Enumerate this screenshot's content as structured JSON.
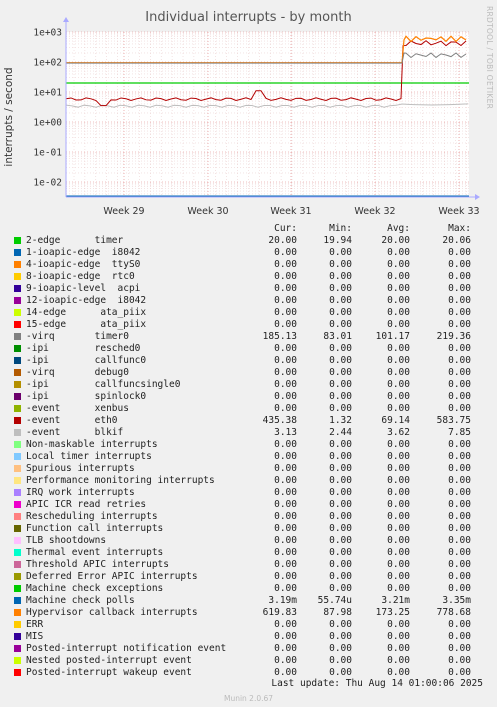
{
  "chart_data": {
    "type": "line",
    "title": "Individual interrupts - by month",
    "ylabel": "interrupts / second",
    "yscale": "log",
    "ylim": [
      0.003,
      1000
    ],
    "y_ticks": [
      "1e-02",
      "1e-01",
      "1e+00",
      "1e+01",
      "1e+02",
      "1e+03"
    ],
    "x_ticks": [
      "Week 29",
      "Week 30",
      "Week 31",
      "Week 32",
      "Week 33"
    ],
    "grid": true,
    "series": [
      {
        "name": "2-edge      timer",
        "values": [
          20.0,
          20.0,
          20.0,
          20.0,
          20.0,
          20.0
        ]
      },
      {
        "name": "-virq       timer0",
        "values": [
          100,
          100,
          100,
          100,
          100,
          110,
          219,
          160,
          185
        ]
      },
      {
        "name": "-event      eth0",
        "values": [
          6,
          5.5,
          6,
          5.8,
          6,
          6.2,
          400,
          435
        ]
      },
      {
        "name": "-event      blkif",
        "values": [
          3.6,
          3.5,
          3.6,
          3.5,
          3.4,
          3.6,
          3.7,
          3.13
        ]
      },
      {
        "name": "Machine check polls",
        "values": [
          0.0035,
          0.0035,
          0.0035,
          0.0035,
          0.0035
        ]
      },
      {
        "name": "Hypervisor callback interrupts",
        "values": [
          95,
          95,
          95,
          95,
          95,
          600,
          778,
          620
        ]
      }
    ]
  },
  "legend_header": {
    "cur": "Cur:",
    "min": "Min:",
    "avg": "Avg:",
    "max": "Max:"
  },
  "legend": [
    {
      "label": "2-edge      timer",
      "color": "#00cc00",
      "cur": "20.00",
      "min": "19.94",
      "avg": "20.00",
      "max": "20.06"
    },
    {
      "label": "1-ioapic-edge  i8042",
      "color": "#0066b3",
      "cur": "0.00",
      "min": "0.00",
      "avg": "0.00",
      "max": "0.00"
    },
    {
      "label": "4-ioapic-edge  ttyS0",
      "color": "#ff8000",
      "cur": "0.00",
      "min": "0.00",
      "avg": "0.00",
      "max": "0.00"
    },
    {
      "label": "8-ioapic-edge  rtc0",
      "color": "#ffcc00",
      "cur": "0.00",
      "min": "0.00",
      "avg": "0.00",
      "max": "0.00"
    },
    {
      "label": "9-ioapic-level  acpi",
      "color": "#330099",
      "cur": "0.00",
      "min": "0.00",
      "avg": "0.00",
      "max": "0.00"
    },
    {
      "label": "12-ioapic-edge  i8042",
      "color": "#990099",
      "cur": "0.00",
      "min": "0.00",
      "avg": "0.00",
      "max": "0.00"
    },
    {
      "label": "14-edge      ata_piix",
      "color": "#ccff00",
      "cur": "0.00",
      "min": "0.00",
      "avg": "0.00",
      "max": "0.00"
    },
    {
      "label": "15-edge      ata_piix",
      "color": "#ff0000",
      "cur": "0.00",
      "min": "0.00",
      "avg": "0.00",
      "max": "0.00"
    },
    {
      "label": "-virq       timer0",
      "color": "#808080",
      "cur": "185.13",
      "min": "83.01",
      "avg": "101.17",
      "max": "219.36"
    },
    {
      "label": "-ipi        resched0",
      "color": "#008f00",
      "cur": "0.00",
      "min": "0.00",
      "avg": "0.00",
      "max": "0.00"
    },
    {
      "label": "-ipi        callfunc0",
      "color": "#00487d",
      "cur": "0.00",
      "min": "0.00",
      "avg": "0.00",
      "max": "0.00"
    },
    {
      "label": "-virq       debug0",
      "color": "#b35a00",
      "cur": "0.00",
      "min": "0.00",
      "avg": "0.00",
      "max": "0.00"
    },
    {
      "label": "-ipi        callfuncsingle0",
      "color": "#b38f00",
      "cur": "0.00",
      "min": "0.00",
      "avg": "0.00",
      "max": "0.00"
    },
    {
      "label": "-ipi        spinlock0",
      "color": "#6b006b",
      "cur": "0.00",
      "min": "0.00",
      "avg": "0.00",
      "max": "0.00"
    },
    {
      "label": "-event      xenbus",
      "color": "#8fb300",
      "cur": "0.00",
      "min": "0.00",
      "avg": "0.00",
      "max": "0.00"
    },
    {
      "label": "-event      eth0",
      "color": "#b30000",
      "cur": "435.38",
      "min": "1.32",
      "avg": "69.14",
      "max": "583.75"
    },
    {
      "label": "-event      blkif",
      "color": "#bebebe",
      "cur": "3.13",
      "min": "2.44",
      "avg": "3.62",
      "max": "7.85"
    },
    {
      "label": "Non-maskable interrupts",
      "color": "#80ff80",
      "cur": "0.00",
      "min": "0.00",
      "avg": "0.00",
      "max": "0.00"
    },
    {
      "label": "Local timer interrupts",
      "color": "#80c9ff",
      "cur": "0.00",
      "min": "0.00",
      "avg": "0.00",
      "max": "0.00"
    },
    {
      "label": "Spurious interrupts",
      "color": "#ffc080",
      "cur": "0.00",
      "min": "0.00",
      "avg": "0.00",
      "max": "0.00"
    },
    {
      "label": "Performance monitoring interrupts",
      "color": "#ffe680",
      "cur": "0.00",
      "min": "0.00",
      "avg": "0.00",
      "max": "0.00"
    },
    {
      "label": "IRQ work interrupts",
      "color": "#aa80ff",
      "cur": "0.00",
      "min": "0.00",
      "avg": "0.00",
      "max": "0.00"
    },
    {
      "label": "APIC ICR read retries",
      "color": "#ee00cc",
      "cur": "0.00",
      "min": "0.00",
      "avg": "0.00",
      "max": "0.00"
    },
    {
      "label": "Rescheduling interrupts",
      "color": "#ff8080",
      "cur": "0.00",
      "min": "0.00",
      "avg": "0.00",
      "max": "0.00"
    },
    {
      "label": "Function call interrupts",
      "color": "#666600",
      "cur": "0.00",
      "min": "0.00",
      "avg": "0.00",
      "max": "0.00"
    },
    {
      "label": "TLB shootdowns",
      "color": "#ffbfff",
      "cur": "0.00",
      "min": "0.00",
      "avg": "0.00",
      "max": "0.00"
    },
    {
      "label": "Thermal event interrupts",
      "color": "#00ffcc",
      "cur": "0.00",
      "min": "0.00",
      "avg": "0.00",
      "max": "0.00"
    },
    {
      "label": "Threshold APIC interrupts",
      "color": "#cc6699",
      "cur": "0.00",
      "min": "0.00",
      "avg": "0.00",
      "max": "0.00"
    },
    {
      "label": "Deferred Error APIC interrupts",
      "color": "#999900",
      "cur": "0.00",
      "min": "0.00",
      "avg": "0.00",
      "max": "0.00"
    },
    {
      "label": "Machine check exceptions",
      "color": "#00cc00",
      "cur": "0.00",
      "min": "0.00",
      "avg": "0.00",
      "max": "0.00"
    },
    {
      "label": "Machine check polls",
      "color": "#0066b3",
      "cur": "3.19m",
      "min": "55.74u",
      "avg": "3.21m",
      "max": "3.35m"
    },
    {
      "label": "Hypervisor callback interrupts",
      "color": "#ff8000",
      "cur": "619.83",
      "min": "87.98",
      "avg": "173.25",
      "max": "778.68"
    },
    {
      "label": "ERR",
      "color": "#ffcc00",
      "cur": "0.00",
      "min": "0.00",
      "avg": "0.00",
      "max": "0.00"
    },
    {
      "label": "MIS",
      "color": "#330099",
      "cur": "0.00",
      "min": "0.00",
      "avg": "0.00",
      "max": "0.00"
    },
    {
      "label": "Posted-interrupt notification event",
      "color": "#990099",
      "cur": "0.00",
      "min": "0.00",
      "avg": "0.00",
      "max": "0.00"
    },
    {
      "label": "Nested posted-interrupt event",
      "color": "#ccff00",
      "cur": "0.00",
      "min": "0.00",
      "avg": "0.00",
      "max": "0.00"
    },
    {
      "label": "Posted-interrupt wakeup event",
      "color": "#ff0000",
      "cur": "0.00",
      "min": "0.00",
      "avg": "0.00",
      "max": "0.00"
    }
  ],
  "footer": "Last update: Thu Aug 14 01:00:06 2025",
  "version": "Munin 2.0.67",
  "watermark": "RRDTOOL / TOBI OETIKER"
}
